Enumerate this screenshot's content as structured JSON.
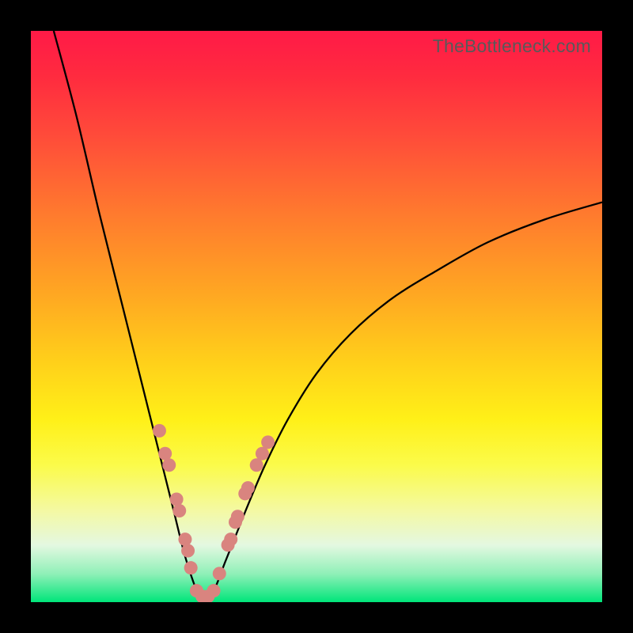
{
  "brand": "TheBottleneck.com",
  "colors": {
    "curve_stroke": "#000000",
    "marker_fill": "#d9847f",
    "marker_stroke": "#c96e69",
    "gradient_top": "#ff1a47",
    "gradient_bottom": "#00e57a"
  },
  "chart_data": {
    "type": "line",
    "title": "",
    "xlabel": "",
    "ylabel": "",
    "xlim": [
      0,
      100
    ],
    "ylim": [
      0,
      100
    ],
    "note": "Bottleneck-style V-curve. Two smooth branches meeting near x≈30 at y≈0; left branch rises steeply toward y→100 as x→0, right branch rises to y≈70 at x=100. Pink markers cluster on both branches near the valley.",
    "series": [
      {
        "name": "left-branch",
        "x": [
          4,
          8,
          12,
          16,
          20,
          23,
          25,
          27,
          29,
          30
        ],
        "y": [
          100,
          85,
          68,
          52,
          36,
          24,
          16,
          8,
          2,
          0
        ]
      },
      {
        "name": "right-branch",
        "x": [
          30,
          32,
          34,
          36,
          38,
          41,
          45,
          50,
          56,
          63,
          71,
          80,
          90,
          100
        ],
        "y": [
          0,
          2,
          7,
          12,
          17,
          24,
          32,
          40,
          47,
          53,
          58,
          63,
          67,
          70
        ]
      }
    ],
    "markers": [
      {
        "x": 22.5,
        "y": 30
      },
      {
        "x": 23.5,
        "y": 26
      },
      {
        "x": 24.2,
        "y": 24
      },
      {
        "x": 25.5,
        "y": 18
      },
      {
        "x": 26.0,
        "y": 16
      },
      {
        "x": 27.0,
        "y": 11
      },
      {
        "x": 27.5,
        "y": 9
      },
      {
        "x": 28.0,
        "y": 6
      },
      {
        "x": 29.0,
        "y": 2
      },
      {
        "x": 30.0,
        "y": 1
      },
      {
        "x": 31.0,
        "y": 1
      },
      {
        "x": 32.0,
        "y": 2
      },
      {
        "x": 33.0,
        "y": 5
      },
      {
        "x": 34.5,
        "y": 10
      },
      {
        "x": 35.0,
        "y": 11
      },
      {
        "x": 35.8,
        "y": 14
      },
      {
        "x": 36.2,
        "y": 15
      },
      {
        "x": 37.5,
        "y": 19
      },
      {
        "x": 38.0,
        "y": 20
      },
      {
        "x": 39.5,
        "y": 24
      },
      {
        "x": 40.5,
        "y": 26
      },
      {
        "x": 41.5,
        "y": 28
      }
    ]
  }
}
